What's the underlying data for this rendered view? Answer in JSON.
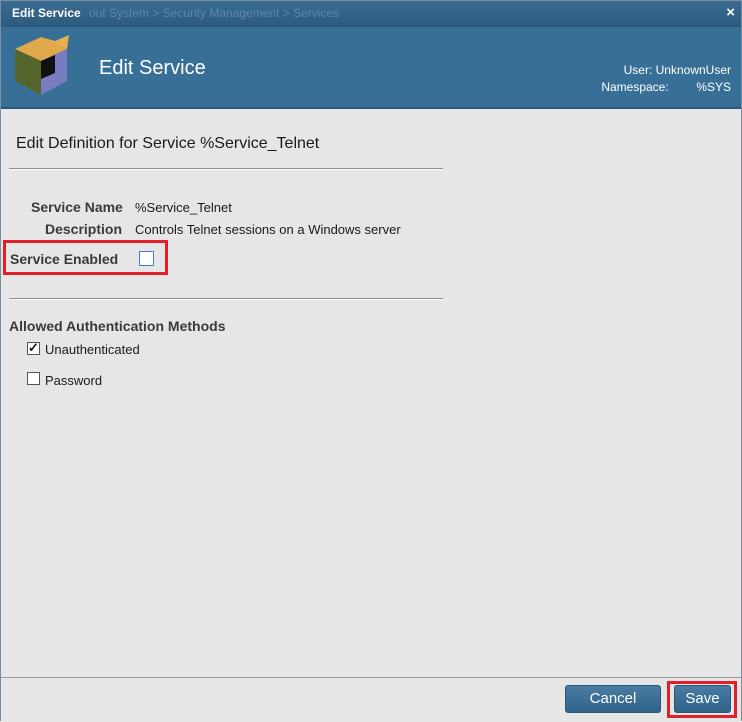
{
  "window": {
    "title": "Edit Service",
    "background_breadcrumb": "out          System > Security Management > Services",
    "close_glyph": "×"
  },
  "header": {
    "title": "Edit Service",
    "user": "User: UnknownUser",
    "namespace_label": "Namespace:",
    "namespace_value": "%SYS",
    "logo_icon": "cube-logo-icon"
  },
  "form": {
    "heading": "Edit Definition for Service %Service_Telnet",
    "service_name_label": "Service Name",
    "service_name_value": "%Service_Telnet",
    "description_label": "Description",
    "description_value": "Controls Telnet sessions on a Windows server",
    "service_enabled_label": "Service Enabled",
    "service_enabled": false,
    "auth_section_title": "Allowed Authentication Methods",
    "auth_methods": [
      {
        "label": "Unauthenticated",
        "checked": true
      },
      {
        "label": "Password",
        "checked": false
      }
    ]
  },
  "footer": {
    "cancel_label": "Cancel",
    "save_label": "Save"
  },
  "colors": {
    "header_bg": "#386f96",
    "titlebar_bg": "#2c5a7e",
    "content_bg": "#e6e6e6",
    "highlight": "#e01f28",
    "button_bg": "#2f6388"
  }
}
